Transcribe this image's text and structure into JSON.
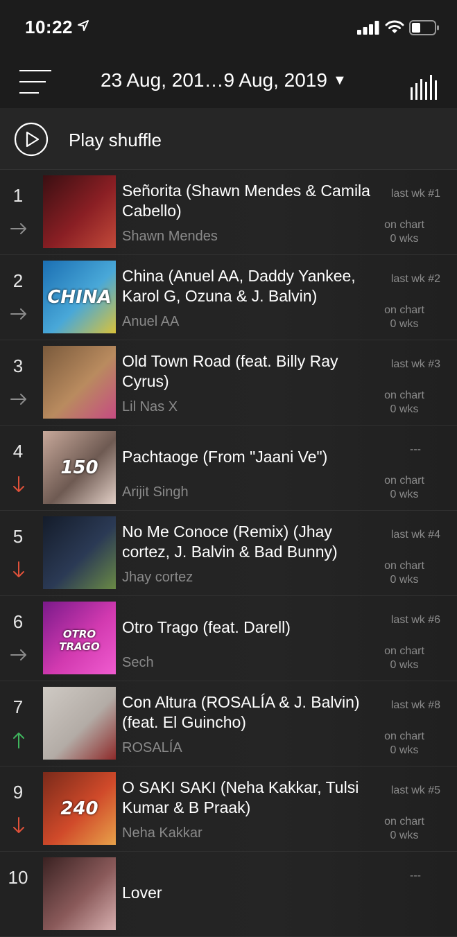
{
  "status_bar": {
    "time": "10:22"
  },
  "header": {
    "date_range": "23 Aug, 201…9 Aug, 2019",
    "caret": "▼"
  },
  "shuffle": {
    "label": "Play shuffle"
  },
  "colors": {
    "background": "#1b1b1b",
    "row": "#242424",
    "trend_same": "#8c8c8c",
    "trend_down": "#e0513a",
    "trend_up": "#3fb55d"
  },
  "chart": [
    {
      "rank": "1",
      "trend": "same",
      "title": "Señorita (Shawn Mendes & Camila Cabello)",
      "artist": "Shawn Mendes",
      "last_wk": "last wk #1",
      "on_chart": "on chart",
      "wks": "0 wks",
      "thumb_colors": [
        "#3a0f12",
        "#8a1f24",
        "#c34a3a"
      ]
    },
    {
      "rank": "2",
      "trend": "same",
      "title": "China (Anuel AA, Daddy Yankee, Karol G, Ozuna & J. Balvin)",
      "artist": "Anuel AA",
      "last_wk": "last wk #2",
      "on_chart": "on chart",
      "wks": "0 wks",
      "thumb_colors": [
        "#1b6fb3",
        "#49a8d8",
        "#d9c23a"
      ],
      "thumb_text": "CHINA"
    },
    {
      "rank": "3",
      "trend": "same",
      "title": "Old Town Road (feat. Billy Ray Cyrus)",
      "artist": "Lil Nas X",
      "last_wk": "last wk #3",
      "on_chart": "on chart",
      "wks": "0 wks",
      "thumb_colors": [
        "#7a5a3c",
        "#b98b5f",
        "#c64b82"
      ]
    },
    {
      "rank": "4",
      "trend": "down",
      "title": "Pachtaoge (From \"Jaani Ve\")",
      "artist": "Arijit Singh",
      "last_wk": "---",
      "on_chart": "on chart",
      "wks": "0 wks",
      "thumb_colors": [
        "#c7a89a",
        "#6e5a52",
        "#e2cfc6"
      ],
      "thumb_text": "150"
    },
    {
      "rank": "5",
      "trend": "down",
      "title": "No Me Conoce (Remix) (Jhay cortez, J. Balvin & Bad Bunny)",
      "artist": "Jhay cortez",
      "last_wk": "last wk #4",
      "on_chart": "on chart",
      "wks": "0 wks",
      "thumb_colors": [
        "#141c2a",
        "#2b3a55",
        "#6a8a45"
      ]
    },
    {
      "rank": "6",
      "trend": "same",
      "title": "Otro Trago (feat. Darell)",
      "artist": "Sech",
      "last_wk": "last wk #6",
      "on_chart": "on chart",
      "wks": "0 wks",
      "thumb_colors": [
        "#7a1a8a",
        "#d23ab0",
        "#f05cd0"
      ],
      "thumb_text": "OTRO TRAGO"
    },
    {
      "rank": "7",
      "trend": "up",
      "title": "Con Altura (ROSALÍA & J. Balvin) (feat. El Guincho)",
      "artist": "ROSALÍA",
      "last_wk": "last wk #8",
      "on_chart": "on chart",
      "wks": "0 wks",
      "thumb_colors": [
        "#cfcac4",
        "#b3aca6",
        "#8e2a2a"
      ]
    },
    {
      "rank": "9",
      "trend": "down",
      "title": "O SAKI SAKI (Neha Kakkar, Tulsi Kumar & B Praak)",
      "artist": "Neha Kakkar",
      "last_wk": "last wk #5",
      "on_chart": "on chart",
      "wks": "0 wks",
      "thumb_colors": [
        "#7a2a1a",
        "#d04a2a",
        "#e8a24a"
      ],
      "thumb_text": "240"
    },
    {
      "rank": "10",
      "trend": "none",
      "title": "Lover",
      "artist": "",
      "last_wk": "---",
      "on_chart": "",
      "wks": "",
      "thumb_colors": [
        "#3a2222",
        "#8a5a5a",
        "#d8b0b0"
      ]
    }
  ]
}
